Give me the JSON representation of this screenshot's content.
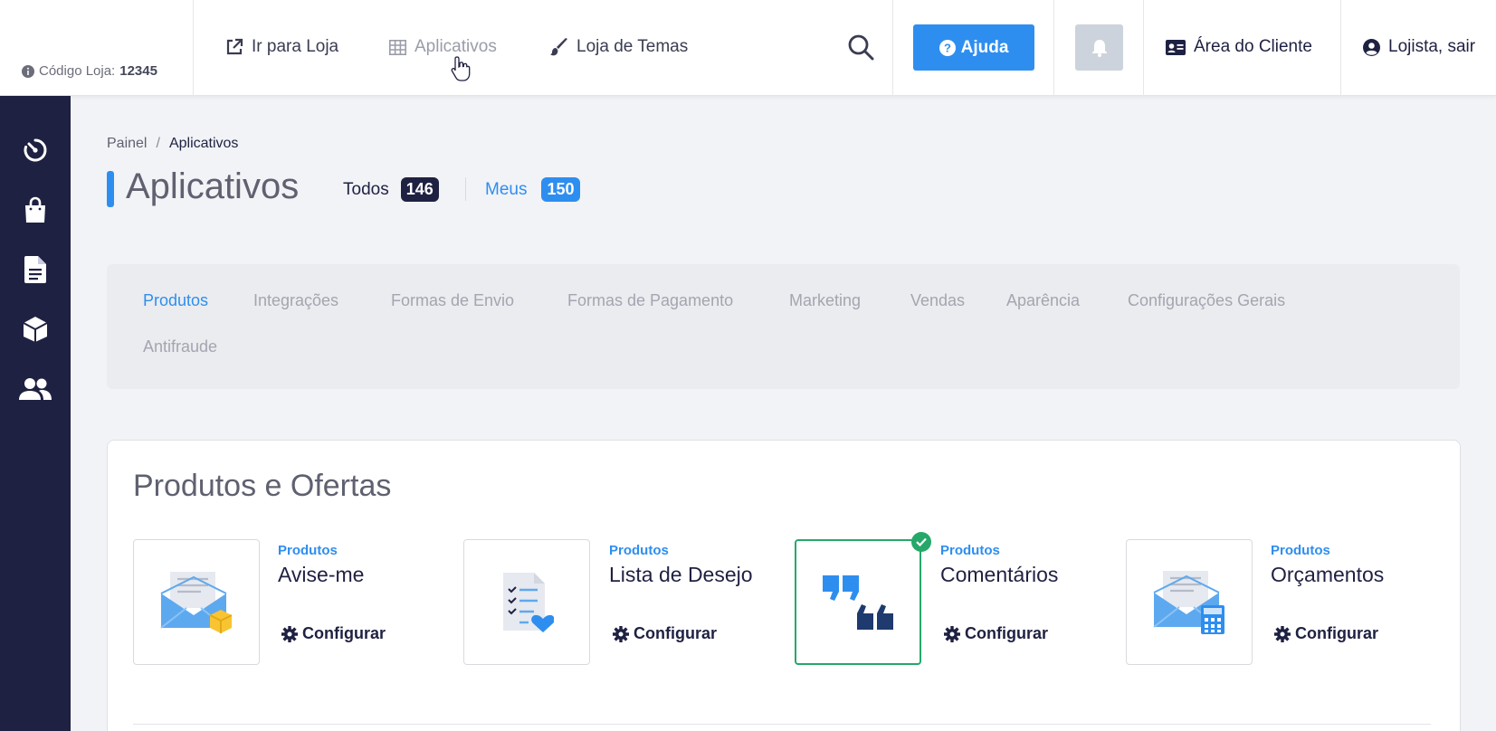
{
  "topbar": {
    "store_code_label": "Código Loja:",
    "store_code_value": "12345",
    "nav": {
      "store": "Ir para Loja",
      "apps": "Aplicativos",
      "themes": "Loja de Temas"
    },
    "help_label": "Ajuda",
    "client_area_label": "Área do Cliente",
    "logout_label": "Lojista, sair"
  },
  "sidebar": {
    "icons": [
      "dashboard-icon",
      "shopping-bag-icon",
      "document-icon",
      "box-icon",
      "users-icon"
    ]
  },
  "breadcrumb": {
    "home": "Painel",
    "separator": "/",
    "current": "Aplicativos"
  },
  "page": {
    "title": "Aplicativos",
    "tab_all_label": "Todos",
    "tab_all_count": "146",
    "tab_mine_label": "Meus",
    "tab_mine_count": "150"
  },
  "categories": [
    "Produtos",
    "Integrações",
    "Formas de Envio",
    "Formas de Pagamento",
    "Marketing",
    "Vendas",
    "Aparência",
    "Configurações Gerais",
    "Antifraude"
  ],
  "section": {
    "title": "Produtos e Ofertas",
    "config_label": "Configurar",
    "apps": [
      {
        "category": "Produtos",
        "name": "Avise-me",
        "installed": false
      },
      {
        "category": "Produtos",
        "name": "Lista de Desejo",
        "installed": false
      },
      {
        "category": "Produtos",
        "name": "Comentários",
        "installed": true
      },
      {
        "category": "Produtos",
        "name": "Orçamentos",
        "installed": false
      }
    ]
  },
  "colors": {
    "accent": "#2e8ef0",
    "sidebar": "#1f2142",
    "success": "#26a86a"
  }
}
